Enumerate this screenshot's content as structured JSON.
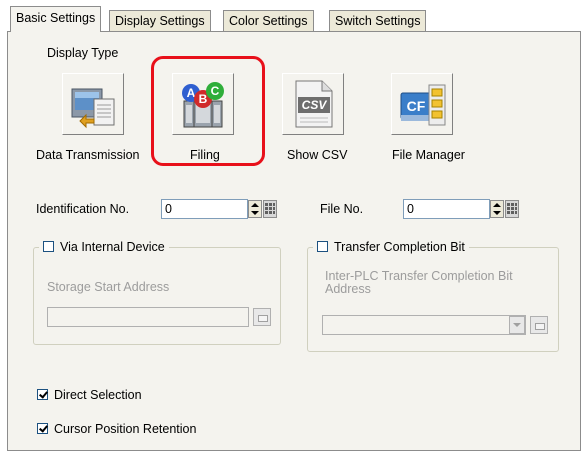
{
  "tabs": [
    {
      "label": "Basic Settings",
      "active": true
    },
    {
      "label": "Display Settings",
      "active": false
    },
    {
      "label": "Color Settings",
      "active": false
    },
    {
      "label": "Switch Settings",
      "active": false
    }
  ],
  "display_type": {
    "heading": "Display Type",
    "options": [
      {
        "label": "Data Transmission",
        "icon": "data-transmission-icon"
      },
      {
        "label": "Filing",
        "icon": "filing-icon",
        "selected": true
      },
      {
        "label": "Show CSV",
        "icon": "csv-file-icon",
        "icon_text": "CSV"
      },
      {
        "label": "File Manager",
        "icon": "file-manager-icon",
        "icon_text": "CF"
      }
    ],
    "highlight_color": "#e8101a"
  },
  "identification": {
    "label": "Identification No.",
    "value": "0"
  },
  "file_no": {
    "label": "File No.",
    "value": "0"
  },
  "via_internal_device": {
    "label": "Via Internal Device",
    "checked": false,
    "storage_label": "Storage Start Address",
    "storage_value": ""
  },
  "transfer_completion": {
    "label": "Transfer Completion Bit",
    "checked": false,
    "address_label": "Inter-PLC Transfer Completion Bit Address",
    "address_value": ""
  },
  "direct_selection": {
    "label": "Direct Selection",
    "checked": true
  },
  "cursor_retention": {
    "label": "Cursor Position Retention",
    "checked": true
  }
}
